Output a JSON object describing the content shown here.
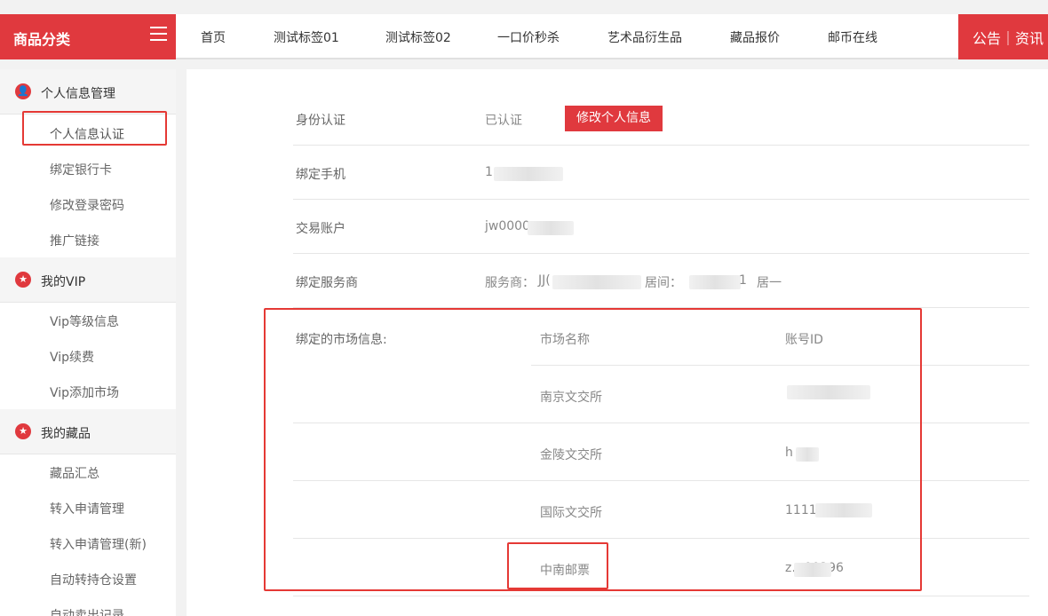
{
  "header": {
    "category_label": "商品分类",
    "nav": [
      "首页",
      "测试标签01",
      "测试标签02",
      "一口价秒杀",
      "艺术品衍生品",
      "藏品报价",
      "邮币在线"
    ],
    "notice": "公告｜资讯"
  },
  "sidebar": {
    "sections": [
      {
        "title": "个人信息管理",
        "items": [
          "个人信息认证",
          "绑定银行卡",
          "修改登录密码",
          "推广链接"
        ]
      },
      {
        "title": "我的VIP",
        "items": [
          "Vip等级信息",
          "Vip续费",
          "Vip添加市场"
        ]
      },
      {
        "title": "我的藏品",
        "items": [
          "藏品汇总",
          "转入申请管理",
          "转入申请管理(新)",
          "自动转持仓设置",
          "自动卖出记录"
        ]
      }
    ]
  },
  "profile": {
    "identity_label": "身份认证",
    "identity_value": "已认证",
    "edit_button": "修改个人信息",
    "phone_label": "绑定手机",
    "phone_value": "1",
    "account_label": "交易账户",
    "account_value": "jw0000",
    "provider_label": "绑定服务商",
    "provider_prefix": "服务商：",
    "provider_value": "JJ(",
    "provider_room_label": "居间：",
    "provider_room_value": "1",
    "provider_room_suffix": "居一"
  },
  "markets": {
    "label": "绑定的市场信息:",
    "col_name": "市场名称",
    "col_id": "账号ID",
    "rows": [
      {
        "name": "南京文交所",
        "id": ""
      },
      {
        "name": "金陵文交所",
        "id": "h"
      },
      {
        "name": "国际文交所",
        "id": "1111"
      },
      {
        "name": "中南邮票",
        "id": "z…00296"
      }
    ]
  },
  "colors": {
    "brand": "#e0393e",
    "annotation": "#e53935"
  }
}
